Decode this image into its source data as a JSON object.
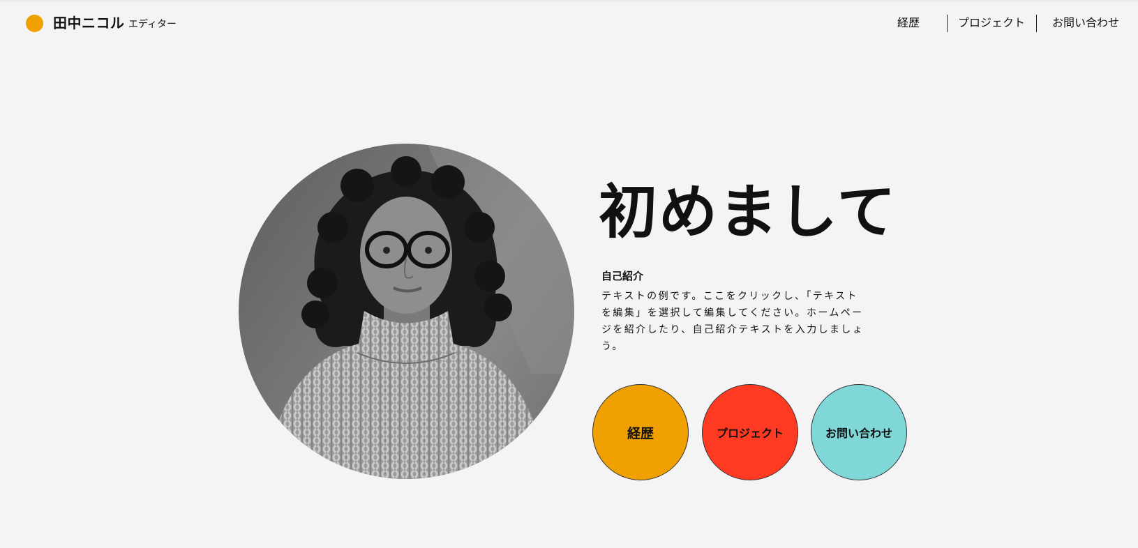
{
  "header": {
    "name": "田中ニコル",
    "role": "エディター",
    "nav": [
      {
        "label": "経歴"
      },
      {
        "label": "プロジェクト"
      },
      {
        "label": "お問い合わせ"
      }
    ]
  },
  "hero": {
    "title": "初めまして",
    "about_heading": "自己紹介",
    "about_body": "テキストの例です。ここをクリックし、「テキストを編集」を選択して編集してください。ホームページを紹介したり、自己紹介テキストを入力しましょう。"
  },
  "buttons": [
    {
      "label": "経歴",
      "color": "#f0a000"
    },
    {
      "label": "プロジェクト",
      "color": "#ff3a22"
    },
    {
      "label": "お問い合わせ",
      "color": "#7fd7d7"
    }
  ],
  "colors": {
    "accent": "#f0a000",
    "background": "#f4f4f4"
  }
}
